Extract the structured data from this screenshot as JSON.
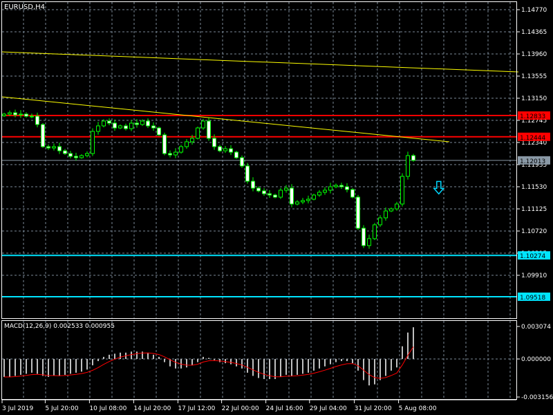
{
  "window": {
    "symbol_label": "EURUSD,H4"
  },
  "colors": {
    "background": "#000000",
    "grid": "#7b8a99",
    "axis": "#ffffff",
    "candle": "#00ff00",
    "bear_fill": "#ffffff",
    "trendline": "#ffff00",
    "resistance": "#ff0000",
    "support": "#00e5ff",
    "bid_line": "#8a99a6",
    "macd_hist": "#c0c0c0",
    "macd_signal": "#ff0000",
    "arrow": "#00d8ff"
  },
  "price_axis": {
    "labels": [
      "1.14770",
      "1.14365",
      "1.13960",
      "1.13555",
      "1.13150",
      "1.12745",
      "1.12340",
      "1.11935",
      "1.11530",
      "1.11125",
      "1.10720",
      "1.10315",
      "1.09910"
    ],
    "max": 1.1477,
    "step": 0.00405
  },
  "price_markers": [
    {
      "label": "1.12833",
      "value": 1.12833,
      "kind": "resistance"
    },
    {
      "label": "1.12444",
      "value": 1.12444,
      "kind": "resistance"
    },
    {
      "label": "1.12013",
      "value": 1.12013,
      "kind": "bid"
    },
    {
      "label": "1.10274",
      "value": 1.10274,
      "kind": "support"
    },
    {
      "label": "1.09518",
      "value": 1.09518,
      "kind": "support"
    }
  ],
  "trendlines": [
    {
      "from_bar": 0,
      "from_price": 1.13998,
      "to_bar": 93,
      "to_price": 1.13631
    },
    {
      "from_bar": 0,
      "from_price": 1.13175,
      "to_bar": 80.5,
      "to_price": 1.12353
    }
  ],
  "signal_arrow": {
    "direction": "down",
    "icon": "arrow-down-icon",
    "bar": 78.6,
    "price": 1.115
  },
  "time_axis": {
    "labels": [
      {
        "text": "3 Jul 2019",
        "bar": 0
      },
      {
        "text": "5 Jul 20:00",
        "bar": 7.8
      },
      {
        "text": "10 Jul 08:00",
        "bar": 15.8
      },
      {
        "text": "14 Jul 20:00",
        "bar": 23.8
      },
      {
        "text": "17 Jul 12:00",
        "bar": 31.8
      },
      {
        "text": "22 Jul 00:00",
        "bar": 39.7
      },
      {
        "text": "24 Jul 16:00",
        "bar": 47.7
      },
      {
        "text": "29 Jul 04:00",
        "bar": 55.6
      },
      {
        "text": "31 Jul 20:00",
        "bar": 63.7
      },
      {
        "text": "5 Aug 08:00",
        "bar": 71.7
      }
    ]
  },
  "macd": {
    "label": "MACD(12,26,9) 0.002533 0.000955",
    "axis_labels": [
      "0.003074",
      "0.000000",
      "-0.003156"
    ],
    "max": 0.003074,
    "min": -0.003156
  },
  "chart_data": [
    {
      "type": "candlestick",
      "title": "EURUSD,H4",
      "ylim": [
        1.093,
        1.149
      ],
      "closes": [
        1.12859,
        1.12884,
        1.12846,
        1.12859,
        1.12821,
        1.12821,
        1.12669,
        1.12264,
        1.12239,
        1.12264,
        1.12188,
        1.12138,
        1.12087,
        1.12062,
        1.121,
        1.12138,
        1.12543,
        1.12644,
        1.12732,
        1.12694,
        1.12606,
        1.12644,
        1.12593,
        1.12694,
        1.12669,
        1.12732,
        1.12644,
        1.12606,
        1.12479,
        1.12138,
        1.12112,
        1.12163,
        1.12264,
        1.12353,
        1.12416,
        1.12606,
        1.12732,
        1.12416,
        1.12264,
        1.12188,
        1.12226,
        1.12163,
        1.12062,
        1.1191,
        1.11631,
        1.11505,
        1.11454,
        1.11403,
        1.11378,
        1.1134,
        1.11467,
        1.11505,
        1.11214,
        1.11252,
        1.11277,
        1.11302,
        1.11378,
        1.11429,
        1.11467,
        1.1153,
        1.11555,
        1.1153,
        1.11479,
        1.1134,
        1.10771,
        1.10454,
        1.10581,
        1.10834,
        1.10961,
        1.11087,
        1.11125,
        1.11214,
        1.1172,
        1.121,
        1.12013
      ]
    },
    {
      "type": "bar+line",
      "title": "MACD(12,26,9)",
      "ylim": [
        -0.003156,
        0.003074
      ],
      "series": [
        {
          "name": "MACD",
          "values": [
            -0.0017,
            -0.0017,
            -0.0016,
            -0.0015,
            -0.0014,
            -0.0013,
            -0.0014,
            -0.0016,
            -0.0017,
            -0.0016,
            -0.0016,
            -0.0015,
            -0.0014,
            -0.0013,
            -0.0012,
            -0.001,
            -0.0006,
            -0.0002,
            0.0002,
            0.0004,
            0.0005,
            0.0006,
            0.0006,
            0.0007,
            0.0007,
            0.0007,
            0.0006,
            0.0004,
            0.0002,
            -0.0003,
            -0.0007,
            -0.0009,
            -0.0009,
            -0.0008,
            -0.0006,
            -0.0003,
            0.0002,
            0.0001,
            -0.0001,
            -0.0003,
            -0.0004,
            -0.0005,
            -0.0007,
            -0.0009,
            -0.0013,
            -0.0016,
            -0.0018,
            -0.0019,
            -0.0019,
            -0.0019,
            -0.0017,
            -0.0015,
            -0.0016,
            -0.0015,
            -0.0014,
            -0.0013,
            -0.0011,
            -0.0009,
            -0.0007,
            -0.0005,
            -0.0003,
            -0.0002,
            -0.0002,
            -0.0004,
            -0.0011,
            -0.002,
            -0.0025,
            -0.0024,
            -0.002,
            -0.0016,
            -0.0011,
            -0.0008,
            0.0012,
            0.0025,
            0.003
          ]
        },
        {
          "name": "Signal",
          "values": [
            -0.0017,
            -0.0017,
            -0.00167,
            -0.00162,
            -0.00155,
            -0.00148,
            -0.00146,
            -0.0015,
            -0.00156,
            -0.00157,
            -0.00158,
            -0.00156,
            -0.00151,
            -0.00145,
            -0.00138,
            -0.00127,
            -0.00107,
            -0.00081,
            -0.00051,
            -0.00024,
            -2e-05,
            0.00017,
            0.0003,
            0.00042,
            0.0005,
            0.00056,
            0.00057,
            0.00052,
            0.00042,
            0.0002,
            -7e-05,
            -0.00032,
            -0.00049,
            -0.00058,
            -0.00059,
            -0.0005,
            -0.00029,
            -0.00017,
            -0.00015,
            -0.00019,
            -0.00025,
            -0.00032,
            -0.00043,
            -0.00057,
            -0.00079,
            -0.00103,
            -0.00126,
            -0.00145,
            -0.00159,
            -0.00168,
            -0.00169,
            -0.00163,
            -0.00162,
            -0.00158,
            -0.00153,
            -0.00146,
            -0.00135,
            -0.00121,
            -0.00106,
            -0.00089,
            -0.00071,
            -0.00056,
            -0.00045,
            -0.00044,
            -0.00064,
            -0.00105,
            -0.00148,
            -0.00176,
            -0.00183,
            -0.00176,
            -0.00156,
            -0.00133,
            -0.00057,
            0.00035,
            0.00115
          ]
        }
      ]
    }
  ]
}
